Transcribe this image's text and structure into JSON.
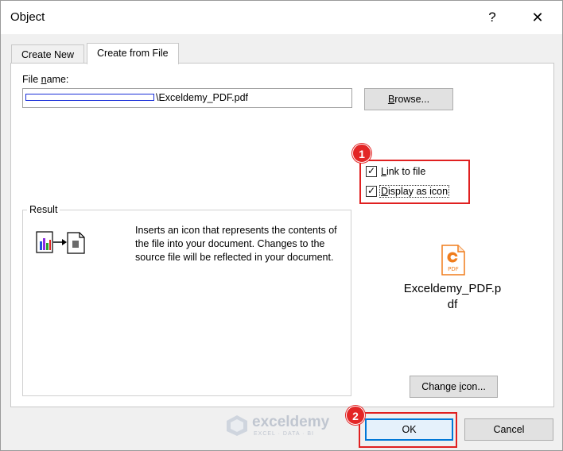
{
  "window": {
    "title": "Object",
    "help_glyph": "?",
    "close_glyph": "✕"
  },
  "tabs": [
    {
      "label": "Create New",
      "active": false
    },
    {
      "label": "Create from File",
      "active": true
    }
  ],
  "file": {
    "label_prefix": "File ",
    "label_underlined": "n",
    "label_suffix": "ame:",
    "value": "\\Exceldemy_PDF.pdf",
    "browse_underlined": "B",
    "browse_rest": "rowse..."
  },
  "options": {
    "link": {
      "underlined": "L",
      "rest": "ink to file",
      "checked": true
    },
    "display": {
      "underlined": "D",
      "rest": "isplay as icon",
      "checked": true
    }
  },
  "result": {
    "label": "Result",
    "text": "Inserts an icon that represents the contents of the file into your document. Changes to the source file will be reflected in your document."
  },
  "icon": {
    "file_name_line1": "Exceldemy_PDF.p",
    "file_name_line2": "df",
    "pdf_tag": "PDF",
    "change_prefix": "Change ",
    "change_underlined": "i",
    "change_rest": "con..."
  },
  "buttons": {
    "ok": "OK",
    "cancel": "Cancel"
  },
  "annotations": {
    "badge1": "1",
    "badge2": "2"
  },
  "watermark": {
    "name": "exceldemy",
    "tagline": "EXCEL · DATA · BI"
  },
  "colors": {
    "annotation_red": "#e02020",
    "focus_blue": "#0078d7",
    "pdf_orange": "#f07d1c"
  }
}
